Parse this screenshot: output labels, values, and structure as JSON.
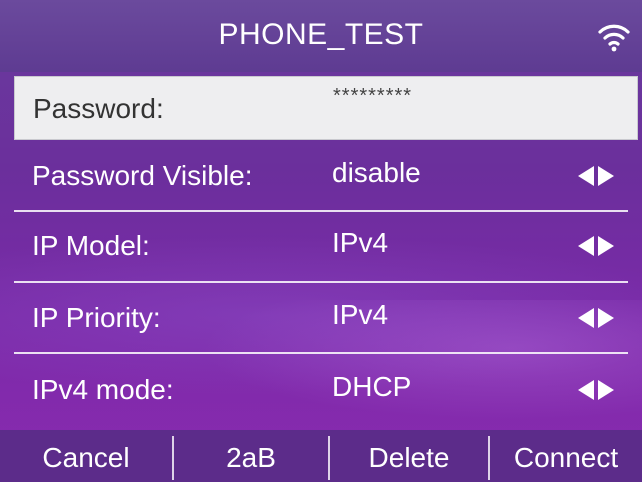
{
  "header": {
    "title": "PHONE_TEST",
    "wifi_icon": "wifi-icon"
  },
  "rows": [
    {
      "label": "Password:",
      "value": "*********",
      "selected": true
    },
    {
      "label": "Password Visible:",
      "value": "disable"
    },
    {
      "label": "IP Model:",
      "value": "IPv4"
    },
    {
      "label": "IP Priority:",
      "value": "IPv4"
    },
    {
      "label": "IPv4 mode:",
      "value": "DHCP"
    }
  ],
  "softkeys": [
    "Cancel",
    "2aB",
    "Delete",
    "Connect"
  ],
  "colors": {
    "background": "#6b2f9c",
    "header": "#5e3b92",
    "selected_row": "#eeeef0",
    "text": "#ffffff"
  }
}
